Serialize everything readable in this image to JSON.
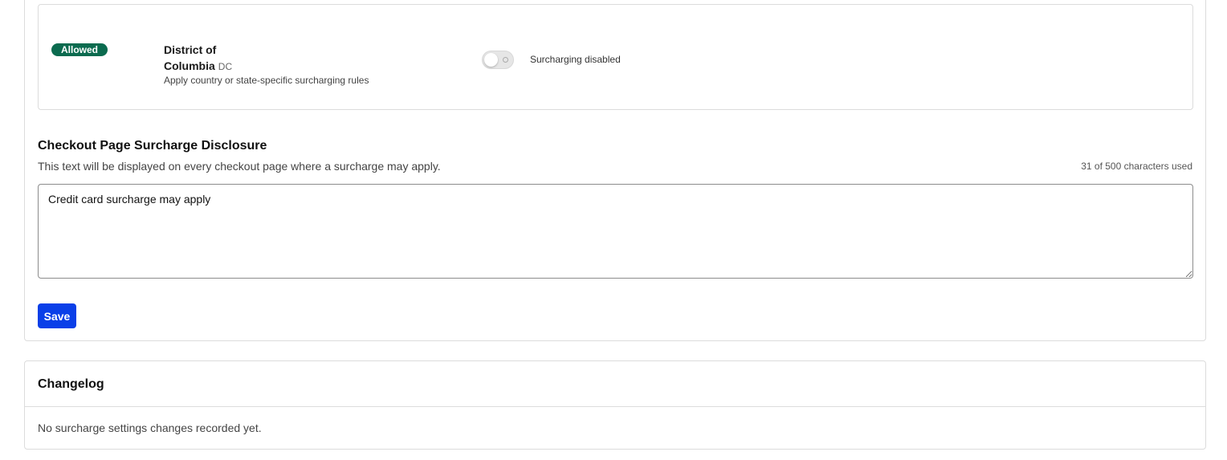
{
  "region": {
    "status": "Allowed",
    "name": "District of Columbia",
    "code": "DC",
    "description": "Apply country or state-specific surcharging rules",
    "toggle_label": "Surcharging disabled",
    "toggle_on": false
  },
  "disclosure": {
    "title": "Checkout Page Surcharge Disclosure",
    "description": "This text will be displayed on every checkout page where a surcharge may apply.",
    "char_count": "31 of 500 characters used",
    "value": "Credit card surcharge may apply",
    "save_label": "Save"
  },
  "changelog": {
    "title": "Changelog",
    "empty_message": "No surcharge settings changes recorded yet."
  },
  "colors": {
    "badge_green": "#0b6b4f",
    "save_blue": "#0a3fe8"
  }
}
